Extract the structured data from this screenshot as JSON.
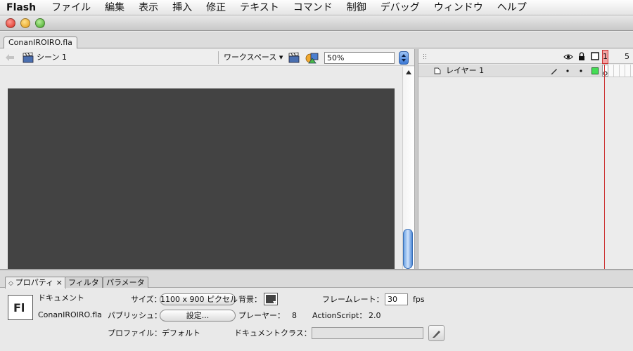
{
  "menubar": {
    "app": "Flash",
    "items": [
      "ファイル",
      "編集",
      "表示",
      "挿入",
      "修正",
      "テキスト",
      "コマンド",
      "制御",
      "デバッグ",
      "ウィンドウ",
      "ヘルプ"
    ]
  },
  "document": {
    "tab_label": "ConanIROIRO.fla"
  },
  "editbar": {
    "scene_label": "シーン 1",
    "workspace_label": "ワークスペース ▾",
    "zoom_value": "50%"
  },
  "timeline": {
    "frame_numbers": [
      "1",
      "5"
    ],
    "layer_name": "レイヤー 1"
  },
  "properties": {
    "tabs": [
      "プロパティ ×",
      "フィルタ",
      "パラメータ"
    ],
    "doc_type_label": "ドキュメント",
    "logo_text": "Fl",
    "file_name": "ConanIROIRO.fla",
    "size_label": "サイズ：",
    "size_value": "1100 x 900 ピクセル",
    "background_label": "背景：",
    "background_color": "#434343",
    "framerate_label": "フレームレート：",
    "framerate_value": "30",
    "fps_label": "fps",
    "publish_label": "パブリッシュ：",
    "settings_button": "設定...",
    "player_label": "プレーヤー：",
    "player_value": "8",
    "actionscript_label": "ActionScript：",
    "actionscript_value": "2.0",
    "profile_label": "プロファイル：デフォルト",
    "doc_class_label": "ドキュメントクラス：",
    "doc_class_value": ""
  },
  "colors": {
    "stage": "#434343",
    "playhead": "#cc3333",
    "layer_color": "#44dd55"
  }
}
